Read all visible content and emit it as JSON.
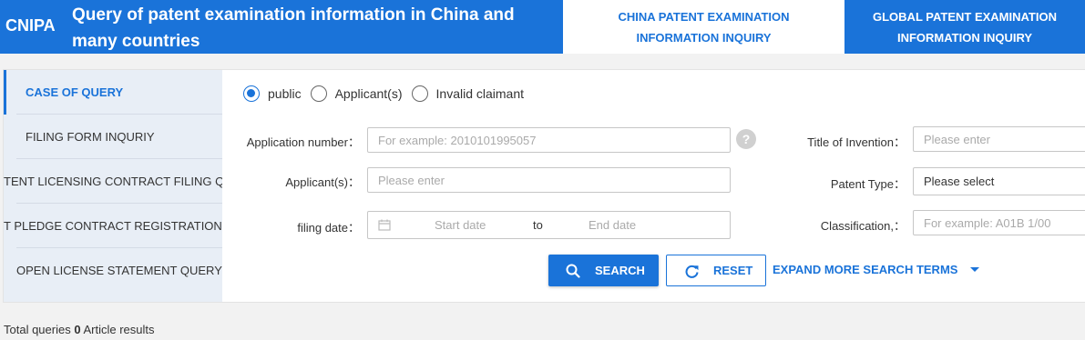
{
  "header": {
    "brand": "CNIPA",
    "title": "Query of patent examination information in China and many countries",
    "tabs": [
      {
        "label": "CHINA PATENT EXAMINATION INFORMATION INQUIRY",
        "active": true
      },
      {
        "label": "GLOBAL PATENT EXAMINATION INFORMATION INQUIRY",
        "active": false
      }
    ]
  },
  "sidebar": {
    "items": [
      {
        "label": "CASE OF QUERY",
        "active": true
      },
      {
        "label": "FILING FORM INQURIY",
        "active": false
      },
      {
        "label": "TENT LICENSING CONTRACT FILING Q",
        "active": false
      },
      {
        "label": "T PLEDGE CONTRACT REGISTRATION",
        "active": false
      },
      {
        "label": "OPEN LICENSE STATEMENT QUERY",
        "active": false
      }
    ]
  },
  "query_type": {
    "options": [
      {
        "label": "public",
        "checked": true
      },
      {
        "label": "Applicant(s)",
        "checked": false
      },
      {
        "label": "Invalid claimant",
        "checked": false
      }
    ]
  },
  "form": {
    "application_number": {
      "label": "Application number：",
      "placeholder": "For example: 2010101995057"
    },
    "help_icon": "?",
    "applicant": {
      "label": "Applicant(s)：",
      "placeholder": "Please enter"
    },
    "filing_date": {
      "label": "filing date：",
      "start_placeholder": "Start date",
      "separator": "to",
      "end_placeholder": "End date"
    },
    "title_of_invention": {
      "label": "Title of Invention：",
      "placeholder": "Please enter"
    },
    "patent_type": {
      "label": "Patent Type：",
      "value": "Please select"
    },
    "classification": {
      "label": "Classification,：",
      "placeholder": "For example: A01B 1/00"
    }
  },
  "actions": {
    "search_label": "SEARCH",
    "reset_label": "RESET",
    "expand_label": "EXPAND MORE SEARCH TERMS"
  },
  "results": {
    "prefix": "Total queries",
    "count": "0",
    "suffix": "Article results"
  },
  "colors": {
    "accent": "#1a73d9",
    "sidebar_bg": "#e8eef6",
    "page_bg": "#f2f2f2"
  },
  "icons": {
    "search": "magnifier-icon",
    "reset": "refresh-icon",
    "calendar": "calendar-icon",
    "expand": "caret-down-icon",
    "help": "question-icon"
  }
}
